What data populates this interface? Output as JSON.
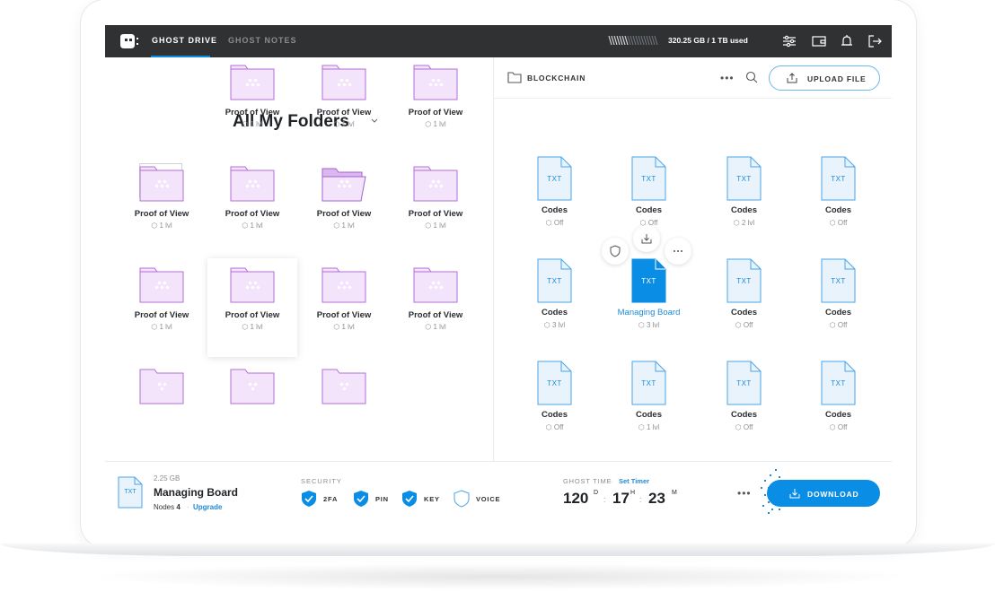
{
  "topbar": {
    "tabs": [
      {
        "label": "GHOST DRIVE",
        "active": true
      },
      {
        "label": "GHOST NOTES",
        "active": false
      }
    ],
    "storage": "320.25 GB / 1 TB used"
  },
  "left": {
    "title": "All My Folders",
    "folders": [
      {
        "name": "Proof of View",
        "meta": "1 lvl"
      },
      {
        "name": "Proof of View",
        "meta": "1 lvl"
      },
      {
        "name": "Proof of View",
        "meta": "1 lvl"
      },
      {
        "name": "Proof of View",
        "meta": "1 lvl"
      },
      {
        "name": "Proof of View",
        "meta": "1 lvl"
      },
      {
        "name": "Proof of View",
        "meta": "1 lvl"
      },
      {
        "name": "Proof of View",
        "meta": "1 lvl"
      },
      {
        "name": "Proof of View",
        "meta": "1 lvl"
      },
      {
        "name": "Proof of View",
        "meta": "1 lvl"
      },
      {
        "name": "Proof of View",
        "meta": "1 lvl"
      },
      {
        "name": "Proof of View",
        "meta": "1 lvl"
      }
    ]
  },
  "right": {
    "breadcrumb": "BLOCKCHAIN",
    "upload_label": "UPLOAD FILE",
    "file_type": "TXT",
    "files": [
      {
        "name": "Codes",
        "meta": "Off"
      },
      {
        "name": "Codes",
        "meta": "Off"
      },
      {
        "name": "Codes",
        "meta": "2 lvl"
      },
      {
        "name": "Codes",
        "meta": "Off"
      },
      {
        "name": "Codes",
        "meta": "3 lvl"
      },
      {
        "name": "Managing Board",
        "meta": "3 lvl"
      },
      {
        "name": "Codes",
        "meta": "Off"
      },
      {
        "name": "Codes",
        "meta": "Off"
      },
      {
        "name": "Codes",
        "meta": "Off"
      },
      {
        "name": "Codes",
        "meta": "1 lvl"
      },
      {
        "name": "Codes",
        "meta": "Off"
      },
      {
        "name": "Codes",
        "meta": "Off"
      }
    ]
  },
  "bottom": {
    "file_type": "TXT",
    "size": "2.25 GB",
    "name": "Managing Board",
    "nodes_label": "Nodes",
    "nodes_count": "4",
    "upgrade": "Upgrade",
    "security_label": "SECURITY",
    "security": [
      {
        "label": "2FA",
        "on": true
      },
      {
        "label": "PIN",
        "on": true
      },
      {
        "label": "KEY",
        "on": true
      },
      {
        "label": "VOICE",
        "on": false
      }
    ],
    "ghost_time_label": "GHOST TIME",
    "set_timer": "Set Timer",
    "days": "120",
    "days_unit": "D",
    "hours": "17",
    "hours_unit": "H",
    "minutes": "23",
    "minutes_unit": "M",
    "download_label": "DOWNLOAD"
  },
  "colors": {
    "accent": "#0a8ee5",
    "topbar": "#2f3133",
    "folder_fill": "#f3e4fb",
    "folder_stroke": "#b36fd6"
  }
}
